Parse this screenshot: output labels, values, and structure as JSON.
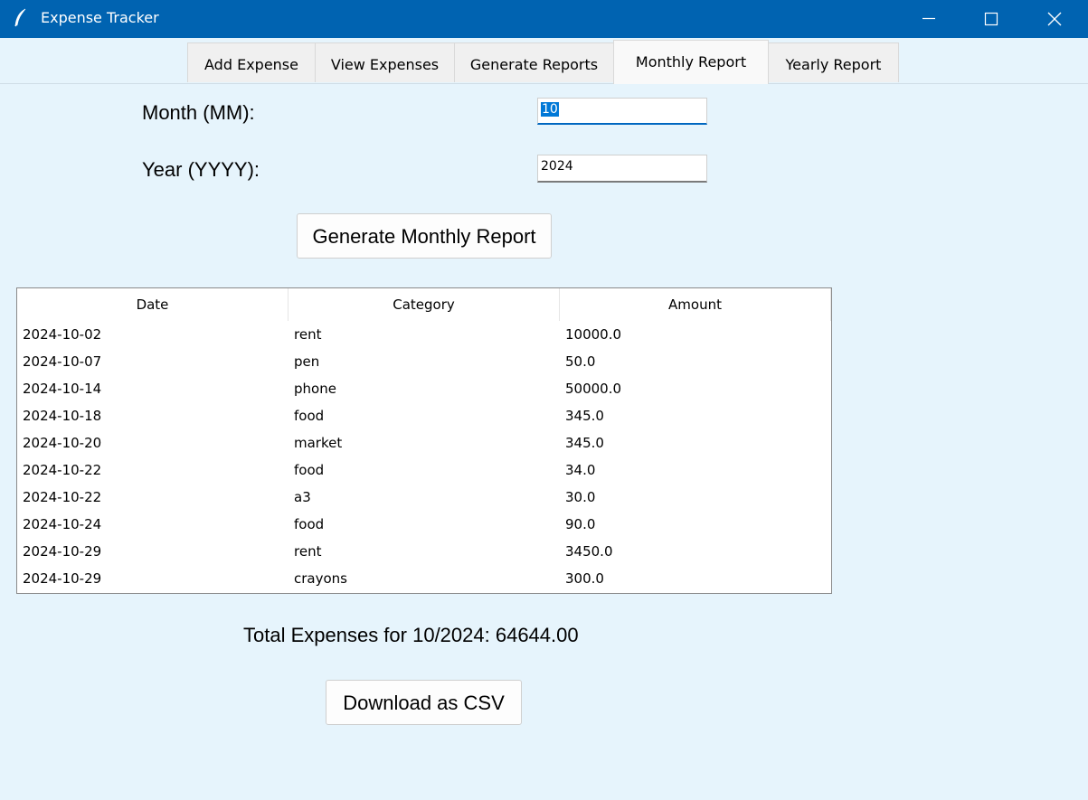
{
  "window": {
    "title": "Expense Tracker"
  },
  "tabs": [
    {
      "label": "Add Expense",
      "active": false
    },
    {
      "label": "View Expenses",
      "active": false
    },
    {
      "label": "Generate Reports",
      "active": false
    },
    {
      "label": "Monthly Report",
      "active": true
    },
    {
      "label": "Yearly Report",
      "active": false
    }
  ],
  "form": {
    "month_label": "Month (MM):",
    "month_value": "10",
    "year_label": "Year (YYYY):",
    "year_value": "2024",
    "generate_button": "Generate Monthly Report"
  },
  "table": {
    "columns": [
      "Date",
      "Category",
      "Amount"
    ],
    "rows": [
      [
        "2024-10-02",
        "rent",
        "10000.0"
      ],
      [
        "2024-10-07",
        "pen",
        "50.0"
      ],
      [
        "2024-10-14",
        "phone",
        "50000.0"
      ],
      [
        "2024-10-18",
        "food",
        "345.0"
      ],
      [
        "2024-10-20",
        "market",
        "345.0"
      ],
      [
        "2024-10-22",
        "food",
        "34.0"
      ],
      [
        "2024-10-22",
        "a3",
        "30.0"
      ],
      [
        "2024-10-24",
        "food",
        "90.0"
      ],
      [
        "2024-10-29",
        "rent",
        "3450.0"
      ],
      [
        "2024-10-29",
        "crayons",
        "300.0"
      ]
    ]
  },
  "summary": {
    "total_text": "Total Expenses for 10/2024: 64644.00"
  },
  "actions": {
    "download_button": "Download as CSV"
  },
  "colors": {
    "titlebar": "#0063b1",
    "background": "#e6f4fc",
    "selection": "#0078d7"
  }
}
